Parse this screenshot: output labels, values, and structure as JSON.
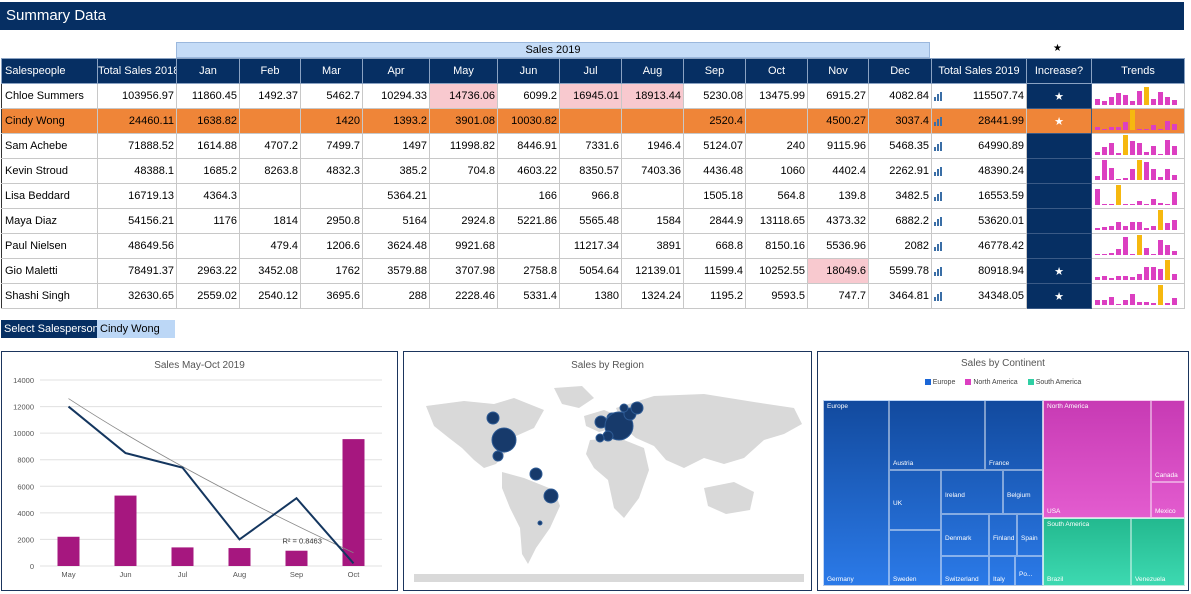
{
  "banner_title": "Summary Data",
  "group_header": "Sales 2019",
  "increase_star_header": "★",
  "columns": [
    "Salespeople",
    "Total Sales 2018",
    "Jan",
    "Feb",
    "Mar",
    "Apr",
    "May",
    "Jun",
    "Jul",
    "Aug",
    "Sep",
    "Oct",
    "Nov",
    "Dec",
    "Total Sales 2019",
    "Increase?",
    "Trends"
  ],
  "rows": [
    {
      "name": "Chloe Summers",
      "t2018": "103956.97",
      "m": [
        "11860.45",
        "1492.37",
        "5462.7",
        "10294.33",
        "14736.06",
        "6099.2",
        "16945.01",
        "18913.44",
        "5230.08",
        "13475.99",
        "6915.27",
        "4082.84"
      ],
      "t2019": "115507.74",
      "inc": "★",
      "trend": [
        0.3,
        0.2,
        0.4,
        0.6,
        0.5,
        0.2,
        0.7,
        0.9,
        0.3,
        0.65,
        0.4,
        0.25
      ],
      "hi": 7
    },
    {
      "name": "Cindy Wong",
      "t2018": "24460.11",
      "m": [
        "1638.82",
        "",
        "1420",
        "1393.2",
        "3901.08",
        "10030.82",
        "",
        "",
        "2520.4",
        "",
        "4500.27",
        "3037.4"
      ],
      "t2019": "28441.99",
      "inc": "★",
      "trend": [
        0.15,
        0,
        0.14,
        0.14,
        0.39,
        1.0,
        0,
        0,
        0.25,
        0,
        0.45,
        0.3
      ],
      "hi": 5
    },
    {
      "name": "Sam Achebe",
      "t2018": "71888.52",
      "m": [
        "1614.88",
        "4707.2",
        "7499.7",
        "1497",
        "11998.82",
        "8446.91",
        "7331.6",
        "1946.4",
        "5124.07",
        "240",
        "9115.96",
        "5468.35"
      ],
      "t2019": "64990.89",
      "inc": "",
      "trend": [
        0.13,
        0.39,
        0.62,
        0.12,
        1.0,
        0.7,
        0.61,
        0.16,
        0.43,
        0.05,
        0.76,
        0.46
      ],
      "hi": 4
    },
    {
      "name": "Kevin Stroud",
      "t2018": "48388.1",
      "m": [
        "1685.2",
        "8263.8",
        "4832.3",
        "385.2",
        "704.8",
        "4603.22",
        "8350.57",
        "7403.36",
        "4436.48",
        "1060",
        "4402.4",
        "2262.91"
      ],
      "t2019": "48390.24",
      "inc": "",
      "trend": [
        0.2,
        0.99,
        0.58,
        0.05,
        0.08,
        0.55,
        1.0,
        0.89,
        0.53,
        0.13,
        0.53,
        0.27
      ],
      "hi": 6
    },
    {
      "name": "Lisa Beddard",
      "t2018": "16719.13",
      "m": [
        "4364.3",
        "",
        "",
        "5364.21",
        "",
        "166",
        "966.8",
        "",
        "1505.18",
        "564.8",
        "139.8",
        "3482.5"
      ],
      "t2019": "16553.59",
      "inc": "",
      "trend": [
        0.81,
        0,
        0,
        1.0,
        0,
        0.05,
        0.18,
        0,
        0.28,
        0.11,
        0.05,
        0.65
      ],
      "hi": 3
    },
    {
      "name": "Maya Diaz",
      "t2018": "54156.21",
      "m": [
        "1176",
        "1814",
        "2950.8",
        "5164",
        "2924.8",
        "5221.86",
        "5565.48",
        "1584",
        "2844.9",
        "13118.65",
        "4373.32",
        "6882.2"
      ],
      "t2019": "53620.01",
      "inc": "",
      "trend": [
        0.09,
        0.14,
        0.22,
        0.39,
        0.22,
        0.4,
        0.42,
        0.12,
        0.22,
        1.0,
        0.33,
        0.52
      ],
      "hi": 9
    },
    {
      "name": "Paul Nielsen",
      "t2018": "48649.56",
      "m": [
        "",
        "479.4",
        "1206.6",
        "3624.48",
        "9921.68",
        "",
        "11217.34",
        "3891",
        "668.8",
        "8150.16",
        "5536.96",
        "2082"
      ],
      "t2019": "46778.42",
      "inc": "",
      "trend": [
        0,
        0.04,
        0.11,
        0.32,
        0.88,
        0,
        1.0,
        0.35,
        0.06,
        0.73,
        0.49,
        0.19
      ],
      "hi": 6
    },
    {
      "name": "Gio Maletti",
      "t2018": "78491.37",
      "m": [
        "2963.22",
        "3452.08",
        "1762",
        "3579.88",
        "3707.98",
        "2758.8",
        "5054.64",
        "12139.01",
        "11599.4",
        "10252.55",
        "18049.6",
        "5599.78"
      ],
      "t2019": "80918.94",
      "inc": "★",
      "trend": [
        0.16,
        0.19,
        0.1,
        0.2,
        0.21,
        0.15,
        0.28,
        0.67,
        0.64,
        0.57,
        1.0,
        0.31
      ],
      "hi": 10
    },
    {
      "name": "Shashi Singh",
      "t2018": "32630.65",
      "m": [
        "2559.02",
        "2540.12",
        "3695.6",
        "288",
        "2228.46",
        "5331.4",
        "1380",
        "1324.24",
        "1195.2",
        "9593.5",
        "747.7",
        "3464.81"
      ],
      "t2019": "34348.05",
      "inc": "★",
      "trend": [
        0.27,
        0.26,
        0.39,
        0.05,
        0.23,
        0.56,
        0.14,
        0.14,
        0.12,
        1.0,
        0.08,
        0.36
      ],
      "hi": 9
    }
  ],
  "selector": {
    "label": "Select Salesperson:",
    "value": "Cindy Wong"
  },
  "chart_data": [
    {
      "type": "bar",
      "title": "Sales May-Oct 2019",
      "categories": [
        "May",
        "Jun",
        "Jul",
        "Aug",
        "Sep",
        "Oct"
      ],
      "values": [
        2200,
        5300,
        1400,
        1350,
        1150,
        9550
      ],
      "line_values": [
        12000,
        8500,
        7400,
        2000,
        5100,
        200
      ],
      "trendline_label": "R² = 0.8463",
      "ylim": [
        0,
        14000
      ],
      "yticks": [
        "0",
        "2000",
        "4000",
        "6000",
        "8000",
        "10000",
        "12000",
        "14000"
      ],
      "grid": true
    },
    {
      "type": "map",
      "title": "Sales by Region"
    },
    {
      "type": "treemap",
      "title": "Sales by Continent",
      "legend": [
        "Europe",
        "North America",
        "South America"
      ],
      "colors": {
        "Europe": "#1b66d6",
        "North America": "#dc3fc1",
        "South America": "#2fcfa4"
      },
      "tiles": [
        "Europe",
        "Germany",
        "Austria",
        "France",
        "UK",
        "Sweden",
        "Ireland",
        "Belgium",
        "Denmark",
        "Switzerland",
        "Finland",
        "Spain",
        "Italy",
        "Po...",
        "North America",
        "USA",
        "Canada",
        "Mexico",
        "South America",
        "Brazil",
        "Venezuela"
      ]
    }
  ]
}
